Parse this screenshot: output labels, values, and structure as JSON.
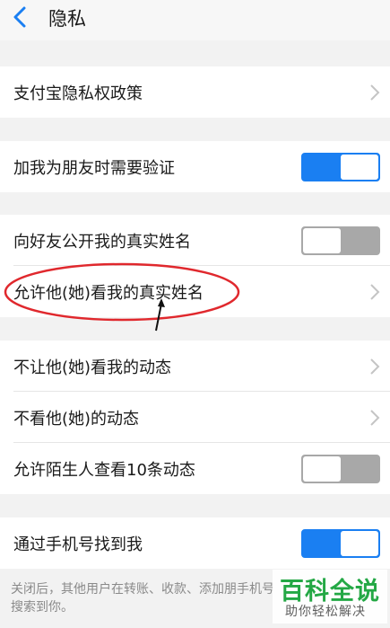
{
  "header": {
    "title": "隐私",
    "back_icon": "back-arrow-icon"
  },
  "sections": {
    "policy": {
      "label": "支付宝隐私权政策"
    },
    "verify": {
      "label": "加我为朋友时需要验证",
      "toggle": "on"
    },
    "real_name_public": {
      "label": "向好友公开我的真实姓名",
      "toggle": "off"
    },
    "allow_real_name": {
      "label": "允许他(她)看我的真实姓名"
    },
    "block_moments": {
      "label": "不让他(她)看我的动态"
    },
    "hide_moments": {
      "label": "不看他(她)的动态"
    },
    "stranger_moments": {
      "label": "允许陌生人查看10条动态",
      "toggle": "off"
    },
    "phone_find": {
      "label": "通过手机号找到我",
      "toggle": "on"
    }
  },
  "footer_note": "关闭后，其他用户在转账、收款、添加朋手机号搜索到你。",
  "watermark": {
    "main": "百科全说",
    "sub": "助你轻松解决"
  },
  "colors": {
    "accent": "#1a7ff2",
    "annotation": "#e0282d",
    "watermark_green": "#24a845"
  }
}
